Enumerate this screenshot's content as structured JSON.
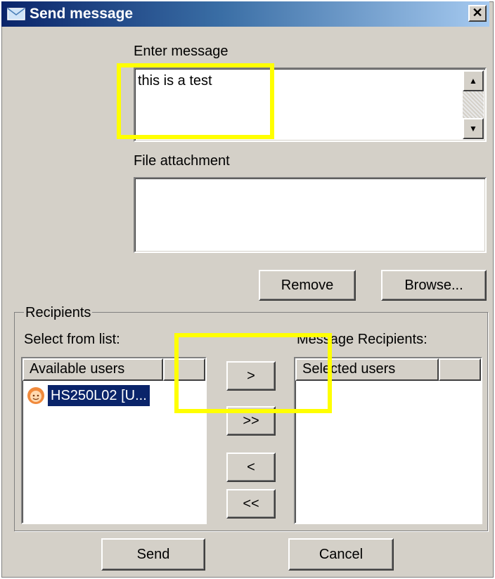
{
  "window": {
    "title": "Send message",
    "close_symbol": "✕"
  },
  "message": {
    "label": "Enter message",
    "value": "this is a test",
    "scroll_up": "▲",
    "scroll_down": "▼"
  },
  "attachment": {
    "label": "File attachment",
    "value": "",
    "remove_label": "Remove",
    "browse_label": "Browse..."
  },
  "recipients": {
    "group_label": "Recipients",
    "select_label": "Select from list:",
    "message_recipients_label": "Message Recipients:",
    "available_header": "Available users",
    "selected_header": "Selected users",
    "available_users": [
      {
        "name": "HS250L02 [U..."
      }
    ],
    "move_one": ">",
    "move_all": ">>",
    "remove_one": "<",
    "remove_all": "<<"
  },
  "actions": {
    "send_label": "Send",
    "cancel_label": "Cancel"
  },
  "colors": {
    "highlight": "#ffff00",
    "selection": "#0a246a",
    "titlebar": "#0a246a"
  }
}
